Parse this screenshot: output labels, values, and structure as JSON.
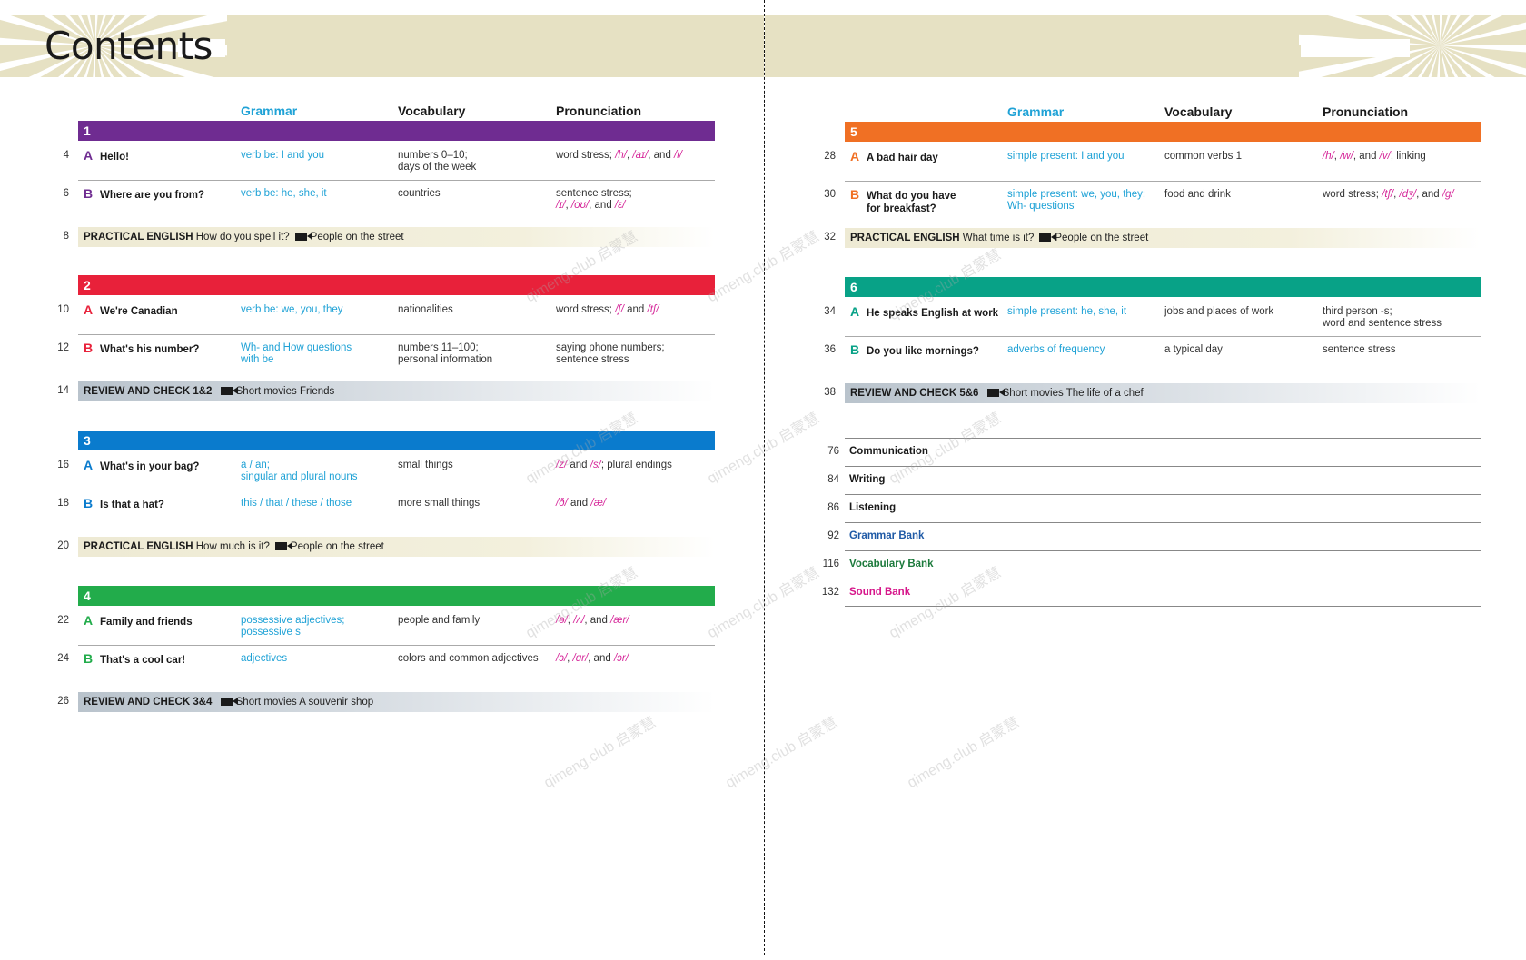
{
  "page_title": "Contents",
  "columns": {
    "grammar": "Grammar",
    "vocabulary": "Vocabulary",
    "pronunciation": "Pronunciation"
  },
  "colors": {
    "unit1": "#6f2c91",
    "unit2": "#e8213a",
    "unit3": "#0a7bcd",
    "unit4": "#22ac4b",
    "unit5": "#f07024",
    "unit6": "#08a287",
    "grammar_text": "#1fa2d6",
    "ipa": "#d6289a",
    "banner": "#e6e1c3"
  },
  "units": [
    {
      "number": "1",
      "lessons": [
        {
          "page": "4",
          "letter": "A",
          "title": "Hello!",
          "grammar": [
            "verb be: I and you"
          ],
          "vocabulary": [
            "numbers 0–10;",
            "days of the week"
          ],
          "pronunciation": [
            "word stress; /h/, /aɪ/, and /i/"
          ]
        },
        {
          "page": "6",
          "letter": "B",
          "title": "Where are you from?",
          "grammar": [
            "verb be: he, she, it"
          ],
          "vocabulary": [
            "countries"
          ],
          "pronunciation": [
            "sentence stress;",
            "/ɪ/, /oʊ/, and /ɛ/"
          ]
        }
      ],
      "band": {
        "page": "8",
        "type": "PRACTICAL ENGLISH",
        "text": "How do you spell it?",
        "video": "People on the street"
      }
    },
    {
      "number": "2",
      "lessons": [
        {
          "page": "10",
          "letter": "A",
          "title": "We're Canadian",
          "grammar": [
            "verb be: we, you, they"
          ],
          "vocabulary": [
            "nationalities"
          ],
          "pronunciation": [
            "word stress; /ʃ/ and /tʃ/"
          ]
        },
        {
          "page": "12",
          "letter": "B",
          "title": "What's his number?",
          "grammar": [
            "Wh- and How questions",
            "with be"
          ],
          "vocabulary": [
            "numbers 11–100;",
            "personal information"
          ],
          "pronunciation": [
            "saying phone numbers;",
            "sentence stress"
          ]
        }
      ],
      "band": {
        "page": "14",
        "type": "REVIEW AND CHECK 1&2",
        "text": "",
        "video": "Short movies Friends"
      }
    },
    {
      "number": "3",
      "lessons": [
        {
          "page": "16",
          "letter": "A",
          "title": "What's in your bag?",
          "grammar": [
            "a / an;",
            "singular and plural nouns"
          ],
          "vocabulary": [
            "small things"
          ],
          "pronunciation": [
            "/z/ and /s/; plural endings"
          ]
        },
        {
          "page": "18",
          "letter": "B",
          "title": "Is that a hat?",
          "grammar": [
            "this / that / these / those"
          ],
          "vocabulary": [
            "more small things"
          ],
          "pronunciation": [
            "/ð/ and /æ/"
          ]
        }
      ],
      "band": {
        "page": "20",
        "type": "PRACTICAL ENGLISH",
        "text": "How much is it?",
        "video": "People on the street"
      }
    },
    {
      "number": "4",
      "lessons": [
        {
          "page": "22",
          "letter": "A",
          "title": "Family and friends",
          "grammar": [
            "possessive adjectives;",
            "possessive s"
          ],
          "vocabulary": [
            "people and family"
          ],
          "pronunciation": [
            "/ə/, /ʌ/, and /ær/"
          ]
        },
        {
          "page": "24",
          "letter": "B",
          "title": "That's a cool car!",
          "grammar": [
            "adjectives"
          ],
          "vocabulary": [
            "colors and common adjectives"
          ],
          "pronunciation": [
            "/ɔ/, /ɑr/, and /ɔr/"
          ]
        }
      ],
      "band": {
        "page": "26",
        "type": "REVIEW AND CHECK 3&4",
        "text": "",
        "video": "Short movies A souvenir shop"
      }
    },
    {
      "number": "5",
      "lessons": [
        {
          "page": "28",
          "letter": "A",
          "title": "A bad hair day",
          "grammar": [
            "simple present: I and you"
          ],
          "vocabulary": [
            "common verbs 1"
          ],
          "pronunciation": [
            "/h/, /w/, and /v/; linking"
          ]
        },
        {
          "page": "30",
          "letter": "B",
          "title": "What do you have for breakfast?",
          "grammar": [
            "simple present: we, you, they;",
            "Wh- questions"
          ],
          "vocabulary": [
            "food and drink"
          ],
          "pronunciation": [
            "word stress; /tʃ/, /dʒ/, and /g/"
          ]
        }
      ],
      "band": {
        "page": "32",
        "type": "PRACTICAL ENGLISH",
        "text": "What time is it?",
        "video": "People on the street"
      }
    },
    {
      "number": "6",
      "lessons": [
        {
          "page": "34",
          "letter": "A",
          "title": "He speaks English at work",
          "grammar": [
            "simple present: he, she, it"
          ],
          "vocabulary": [
            "jobs and places of work"
          ],
          "pronunciation": [
            "third person -s;",
            "word and sentence stress"
          ]
        },
        {
          "page": "36",
          "letter": "B",
          "title": "Do you like mornings?",
          "grammar": [
            "adverbs of frequency"
          ],
          "vocabulary": [
            "a typical day"
          ],
          "pronunciation": [
            "sentence stress"
          ]
        }
      ],
      "band": {
        "page": "38",
        "type": "REVIEW AND CHECK 5&6",
        "text": "",
        "video": "Short movies The life of a chef"
      }
    }
  ],
  "extras": [
    {
      "page": "76",
      "label": "Communication",
      "color": "#1a1a1a"
    },
    {
      "page": "84",
      "label": "Writing",
      "color": "#1a1a1a"
    },
    {
      "page": "86",
      "label": "Listening",
      "color": "#1a1a1a"
    },
    {
      "page": "92",
      "label": "Grammar Bank",
      "color": "#1f5aa6"
    },
    {
      "page": "116",
      "label": "Vocabulary Bank",
      "color": "#1c7a3c"
    },
    {
      "page": "132",
      "label": "Sound Bank",
      "color": "#d6168a"
    }
  ],
  "watermark": "qimeng.club 启蒙慧"
}
